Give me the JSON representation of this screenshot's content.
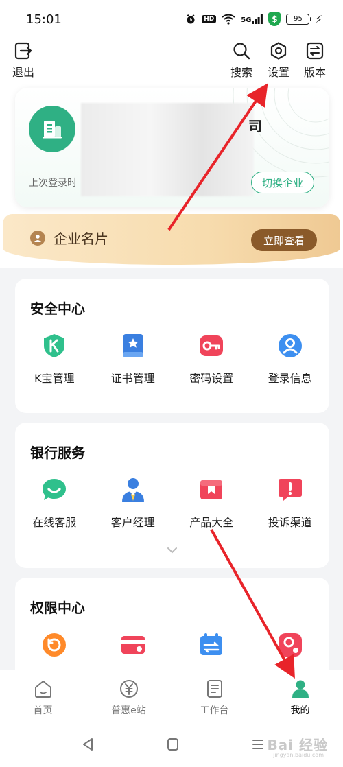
{
  "status_bar": {
    "time": "15:01",
    "hd": "HD",
    "network": "5G",
    "shield": "$",
    "battery": "95"
  },
  "top_bar": {
    "logout_label": "退出",
    "search_label": "搜索",
    "settings_label": "设置",
    "version_label": "版本"
  },
  "company_card": {
    "name_tail": "司",
    "last_login": "上次登录时",
    "switch_label": "切换企业",
    "accent": "#2fb084"
  },
  "biz_banner": {
    "label": "企业名片",
    "button": "立即查看"
  },
  "security_center": {
    "title": "安全中心",
    "items": [
      {
        "label": "K宝管理",
        "icon": "k-shield-icon"
      },
      {
        "label": "证书管理",
        "icon": "certificate-icon"
      },
      {
        "label": "密码设置",
        "icon": "key-icon"
      },
      {
        "label": "登录信息",
        "icon": "user-login-icon"
      }
    ]
  },
  "bank_services": {
    "title": "银行服务",
    "items": [
      {
        "label": "在线客服",
        "icon": "chat-bubble-icon"
      },
      {
        "label": "客户经理",
        "icon": "manager-icon"
      },
      {
        "label": "产品大全",
        "icon": "product-box-icon"
      },
      {
        "label": "投诉渠道",
        "icon": "complaint-icon"
      }
    ]
  },
  "permission_center": {
    "title": "权限中心"
  },
  "tabs": [
    {
      "label": "首页",
      "icon": "home-icon"
    },
    {
      "label": "普惠e站",
      "icon": "yen-coin-icon"
    },
    {
      "label": "工作台",
      "icon": "workbench-icon"
    },
    {
      "label": "我的",
      "icon": "profile-icon"
    }
  ],
  "watermark": {
    "text": "Bai 经验",
    "sub": "jingyan.baidu.com"
  }
}
